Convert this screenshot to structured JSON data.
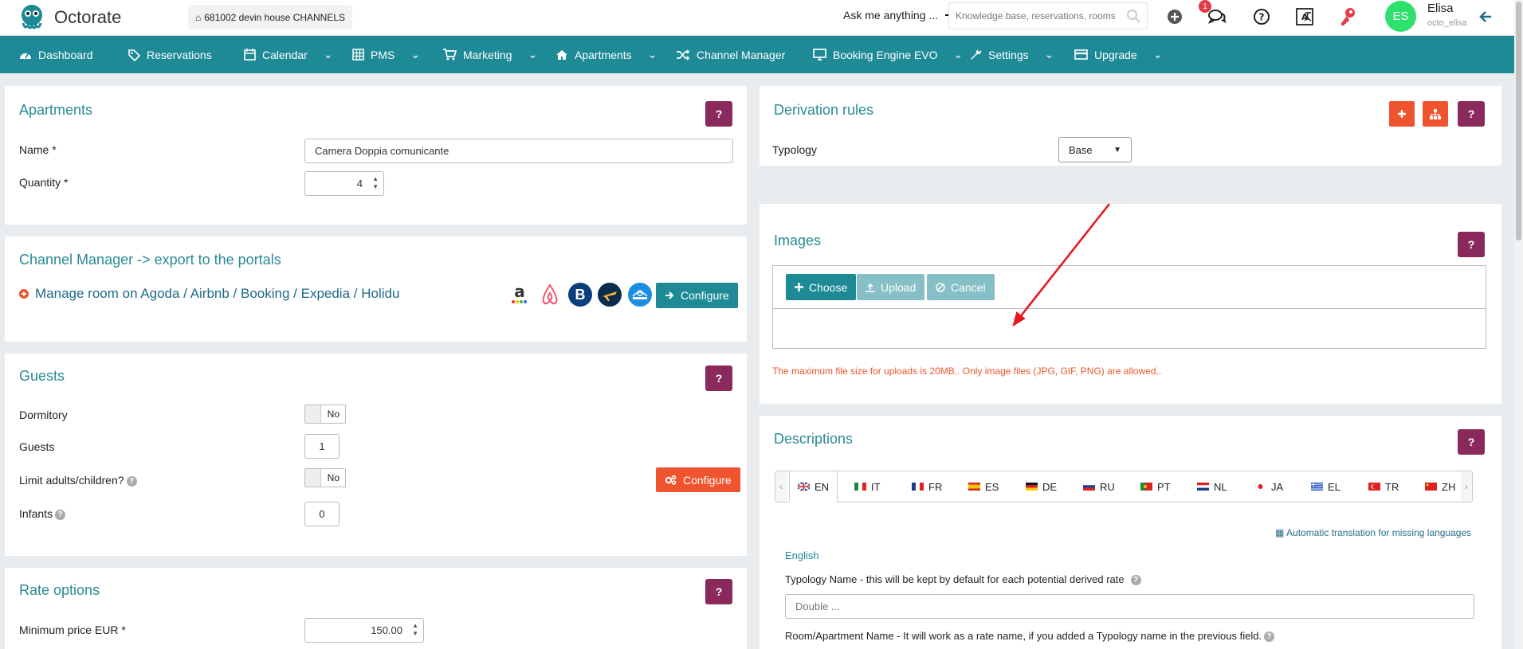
{
  "header": {
    "brand": "Octorate",
    "property": "681002  devin house CHANNELS",
    "ask_label": "Ask me anything ...",
    "search_placeholder": "Knowledge base, reservations, rooms or",
    "notification_count": "1",
    "avatar_initials": "ES",
    "user_name": "Elisa",
    "user_handle": "octo_elisa"
  },
  "nav": {
    "items": [
      {
        "label": "Dashboard",
        "icon": "gauge-icon"
      },
      {
        "label": "Reservations",
        "icon": "tag-icon"
      },
      {
        "label": "Calendar",
        "icon": "calendar-icon"
      },
      {
        "label": "PMS",
        "icon": "grid-icon"
      },
      {
        "label": "Marketing",
        "icon": "cart-icon"
      },
      {
        "label": "Apartments",
        "icon": "home-icon"
      },
      {
        "label": "Channel Manager",
        "icon": "shuffle-icon"
      },
      {
        "label": "Booking Engine EVO",
        "icon": "desktop-icon"
      },
      {
        "label": "Settings",
        "icon": "wrench-icon"
      },
      {
        "label": "Upgrade",
        "icon": "card-icon"
      }
    ]
  },
  "apartments": {
    "title": "Apartments",
    "name_label": "Name *",
    "name_value": "Camera Doppia comunicante",
    "quantity_label": "Quantity *",
    "quantity_value": "4"
  },
  "channel_manager": {
    "title": "Channel Manager -> export to the portals",
    "manage_text": "Manage room on Agoda / Airbnb / Booking / Expedia / Holidu",
    "configure_label": "Configure"
  },
  "guests": {
    "title": "Guests",
    "dormitory_label": "Dormitory",
    "dormitory_value": "No",
    "guests_label": "Guests",
    "guests_value": "1",
    "limit_label": "Limit adults/children?",
    "limit_value": "No",
    "infants_label": "Infants",
    "infants_value": "0",
    "configure_label": "Configure"
  },
  "rate_options": {
    "title": "Rate options",
    "min_price_label": "Minimum price EUR  *",
    "min_price_value": "150.00"
  },
  "derivation": {
    "title": "Derivation rules",
    "typology_label": "Typology",
    "typology_value": "Base"
  },
  "images": {
    "title": "Images",
    "choose_label": "Choose",
    "upload_label": "Upload",
    "cancel_label": "Cancel",
    "note": "The maximum file size for uploads is 20MB.. Only image files (JPG, GIF, PNG) are allowed.."
  },
  "descriptions": {
    "title": "Descriptions",
    "tabs": [
      "EN",
      "IT",
      "FR",
      "ES",
      "DE",
      "RU",
      "PT",
      "NL",
      "JA",
      "EL",
      "TR",
      "ZH"
    ],
    "auto_translation": "Automatic translation for missing languages",
    "language_heading": "English",
    "typology_name_label": "Typology Name - this will be kept by default for each potential derived rate",
    "typology_name_placeholder": "Double ...",
    "room_name_label": "Room/Apartment Name - It will work as a rate name, if you added a Typology name in the previous field."
  },
  "help_label": "?"
}
